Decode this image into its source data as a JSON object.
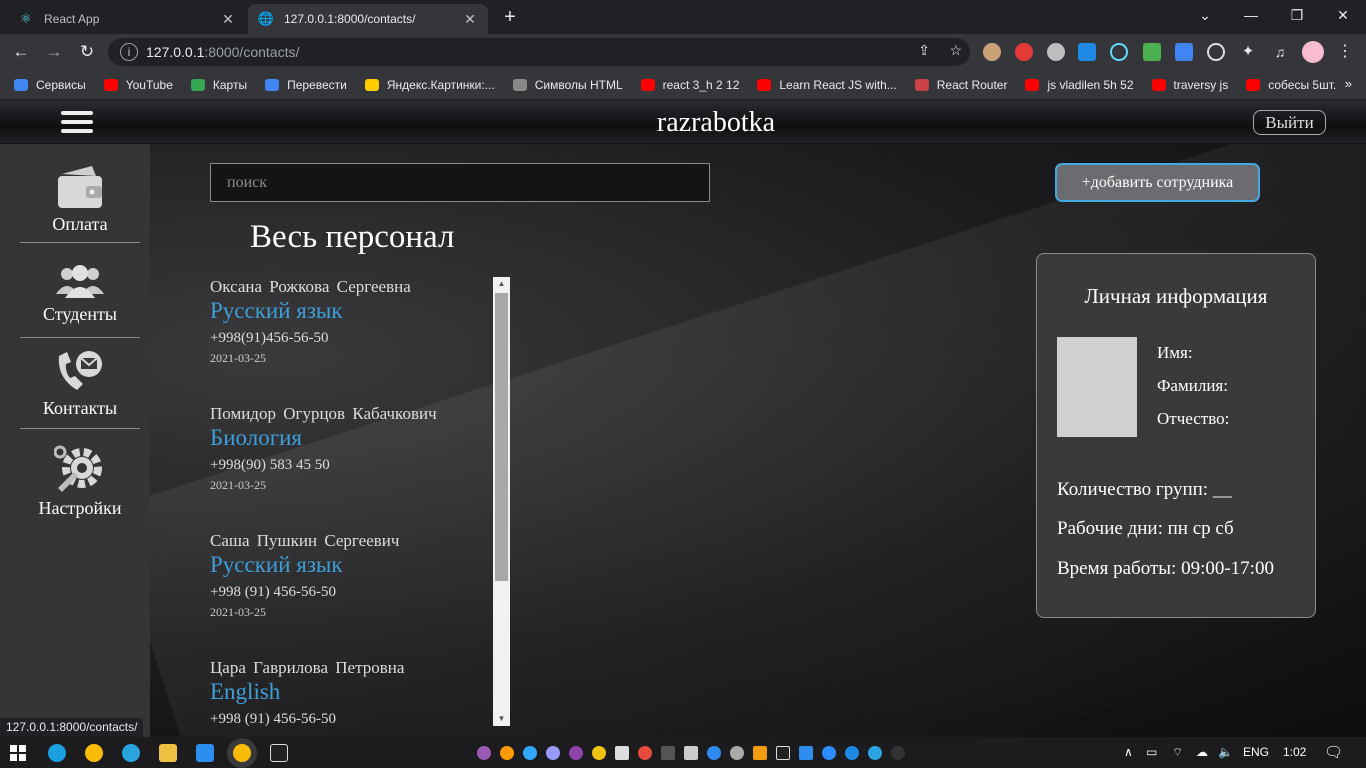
{
  "browser": {
    "tabs": [
      {
        "title": "React App",
        "active": false
      },
      {
        "title": "127.0.0.1:8000/contacts/",
        "active": true
      }
    ],
    "url_host": "127.0.0.1",
    "url_path": ":8000/contacts/",
    "bookmarks": [
      {
        "label": "Сервисы",
        "color": "#4285f4"
      },
      {
        "label": "YouTube",
        "color": "#ff0000"
      },
      {
        "label": "Карты",
        "color": "#34a853"
      },
      {
        "label": "Перевести",
        "color": "#4285f4"
      },
      {
        "label": "Яндекс.Картинки:...",
        "color": "#ffcc00"
      },
      {
        "label": "Символы HTML",
        "color": "#888888"
      },
      {
        "label": "react 3_h 2 12",
        "color": "#ff0000"
      },
      {
        "label": "Learn React JS with...",
        "color": "#ff0000"
      },
      {
        "label": "React Router",
        "color": "#ca4245"
      },
      {
        "label": "js vladilen 5h 52",
        "color": "#ff0000"
      },
      {
        "label": "traversy js",
        "color": "#ff0000"
      },
      {
        "label": "собесы 5шт.",
        "color": "#ff0000"
      }
    ],
    "status_url": "127.0.0.1:8000/contacts/"
  },
  "header": {
    "brand": "razrabotka",
    "logout_label": "Выйти"
  },
  "sidebar": {
    "items": [
      {
        "label": "Оплата",
        "icon": "wallet-icon"
      },
      {
        "label": "Студенты",
        "icon": "users-icon"
      },
      {
        "label": "Контакты",
        "icon": "phone-contact-icon"
      },
      {
        "label": "Настройки",
        "icon": "settings-gear-icon"
      }
    ]
  },
  "main": {
    "search_placeholder": "поиск",
    "add_button_label": "+добавить сотрудника",
    "section_title": "Весь персонал",
    "employees": [
      {
        "name": "Оксана Рожкова Сергеевна",
        "subject": "Русский язык",
        "phone": "+998(91)456-56-50",
        "date": "2021-03-25"
      },
      {
        "name": "Помидор Огурцов Кабачкович",
        "subject": "Биология",
        "phone": "+998(90) 583 45 50",
        "date": "2021-03-25"
      },
      {
        "name": "Саша Пушкин Сергеевич",
        "subject": "Русский язык",
        "phone": "+998 (91) 456-56-50",
        "date": "2021-03-25"
      },
      {
        "name": "Цара Гаврилова Петровна",
        "subject": "English",
        "phone": "+998 (91) 456-56-50",
        "date": ""
      }
    ]
  },
  "info_card": {
    "title": "Личная информация",
    "first_name_label": "Имя:",
    "last_name_label": "Фамилия:",
    "patronymic_label": "Отчество:",
    "groups_count": "Количество групп: __",
    "work_days": "Рабочие дни: пн ср сб",
    "work_hours": "Время работы: 09:00-17:00"
  },
  "taskbar": {
    "language": "ENG",
    "time": "1:02"
  }
}
